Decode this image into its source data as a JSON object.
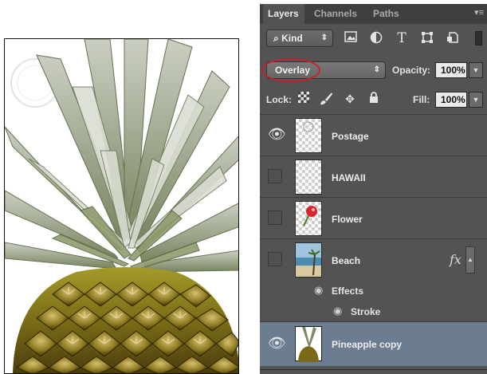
{
  "panel": {
    "tabs": [
      {
        "label": "Layers",
        "active": true
      },
      {
        "label": "Channels",
        "active": false
      },
      {
        "label": "Paths",
        "active": false
      }
    ],
    "filter": {
      "kind_label": "Kind",
      "search_glyph": "⌕",
      "icons": [
        "image-filter-icon",
        "adjustment-filter-icon",
        "type-filter-icon",
        "shape-filter-icon",
        "smart-object-filter-icon"
      ]
    },
    "blend": {
      "mode": "Overlay",
      "opacity_label": "Opacity:",
      "opacity_value": "100%"
    },
    "lock": {
      "lock_label": "Lock:",
      "fill_label": "Fill:",
      "fill_value": "100%"
    },
    "layers": [
      {
        "name": "Postage",
        "visible": true,
        "thumb": "transparent-stamp"
      },
      {
        "name": "HAWAII",
        "visible": false,
        "thumb": "transparent-text"
      },
      {
        "name": "Flower",
        "visible": false,
        "thumb": "flower"
      },
      {
        "name": "Beach",
        "visible": false,
        "thumb": "beach",
        "has_fx": true,
        "fx_label": "fx"
      },
      {
        "name": "Pineapple copy",
        "visible": true,
        "selected": true,
        "thumb": "pineapple"
      }
    ],
    "effects": {
      "effects_label": "Effects",
      "stroke_label": "Stroke"
    },
    "colors": {
      "panel_bg": "#535353",
      "selected_row": "#6c7d92",
      "highlight_ring": "#c8202a"
    }
  }
}
